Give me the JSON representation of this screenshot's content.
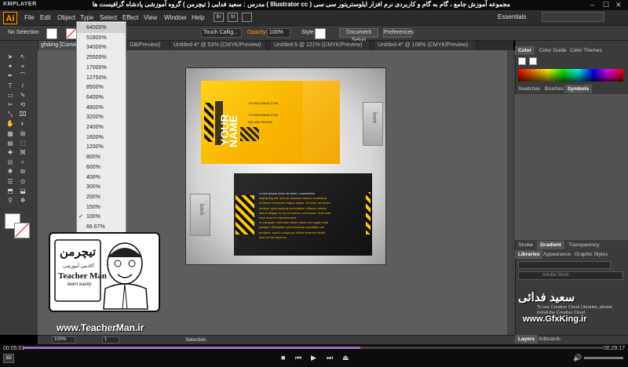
{
  "player": {
    "logo": "KMPLAYER",
    "title": "مجموعه آموزش جامع ، گام به گام و کاربردی نرم افزار ایلوستریتور سی سی ( Illustrator cc )   مدرس : سعید فدایی ( تیچرمن ) گروه آموزشی پادشاه گرافیست ها",
    "time_elapsed": "00:05:01",
    "time_total": "00:29:17",
    "progress": 0.58,
    "min": "‒",
    "max": "☐",
    "close": "✕"
  },
  "app": {
    "logo": "Ai",
    "menu": [
      "File",
      "Edit",
      "Object",
      "Type",
      "Select",
      "Effect",
      "View",
      "Window",
      "Help"
    ],
    "mini_icons": [
      "Br",
      "St"
    ],
    "workspace": "Essentials"
  },
  "controls": {
    "selection": "No Selection",
    "stroke_label": "Stroke:",
    "brush": "Touch Callig...",
    "opacity_label": "Opacity:",
    "opacity_value": "100%",
    "style_label": "Style:",
    "doc_setup": "Document Setup",
    "preferences": "Preferences"
  },
  "tabs": [
    {
      "label": "gfxking [Conve...",
      "active": true
    },
    {
      "label": "GB/Preview)",
      "active": false
    },
    {
      "label": "Untitled-4* @ 53% (CMYK/Preview)",
      "active": false
    },
    {
      "label": "Untitled-5 @ 121% (CMYK/Preview)",
      "active": false
    },
    {
      "label": "Untitled-4* @ 108% (CMYK/Preview)",
      "active": false
    }
  ],
  "zoom_menu": {
    "items": [
      "64000%",
      "51800%",
      "34000%",
      "25500%",
      "17000%",
      "12750%",
      "8500%",
      "6400%",
      "4800%",
      "3200%",
      "2400%",
      "1600%",
      "1200%",
      "800%",
      "600%",
      "400%",
      "300%",
      "200%",
      "150%",
      "100%",
      "66.67%"
    ],
    "checked": "100%",
    "highlighted": "64000%"
  },
  "card": {
    "your": "YOUR",
    "name": "NAME",
    "url": "YOURDOMAIN.COM",
    "phone": "555-456-789-000",
    "front_label": "front",
    "back_label": "back",
    "back_lines": [
      "Lorem ipsum dolor sit amet, consectetur",
      "adipiscing elit, sed do eiusmod tempor incididunt",
      "ut labore et dolore magna aliqua. Ut enim ad minim",
      "veniam, quis nostrud exercitation ullamco laboris",
      "nisi ut aliquip ex ea commodo consequat. Duis aute",
      "irure dolor in reprehenderit",
      "in voluptate velit esse cillum dolore eu fugiat nulla",
      "pariatur. Excepteur sint occaecat cupidatat non",
      "proident, sunt in culpa qui officia deserunt mollit",
      "anim id est laborum."
    ]
  },
  "right_panel": {
    "top_tabs": [
      "Color",
      "Color Guide",
      "Color Themes"
    ],
    "mid_tabs": [
      "Swatches",
      "Brushes",
      "Symbols"
    ],
    "gradient_tabs": [
      "Stroke",
      "Gradient",
      "Transparency"
    ],
    "lib_tabs": [
      "Libraries",
      "Appearance",
      "Graphic Styles"
    ],
    "lib_search": "Adobe Stock",
    "lib_message": "To use Creative Cloud Libraries, please install the Creative Cloud",
    "bottom_tabs": [
      "Layers",
      "Artboards"
    ]
  },
  "status": {
    "zoom": "100%",
    "artboard": "1",
    "tool": "Selection",
    "fit": "Fit On Screen"
  },
  "overlay": {
    "brand_fa": "تیچرمن",
    "brand_sub": "آکادمی آموزشی",
    "brand_en": "Teacher Man",
    "brand_tag": "learn easily",
    "site_left": "www.TeacherMan.ir",
    "site_right": "www.GfxKing.ir",
    "signature": "سعید فدائی"
  },
  "colors": {
    "accent": "#ff9a00",
    "card_yellow": "#f7b400",
    "progress": "#9a6acb"
  }
}
